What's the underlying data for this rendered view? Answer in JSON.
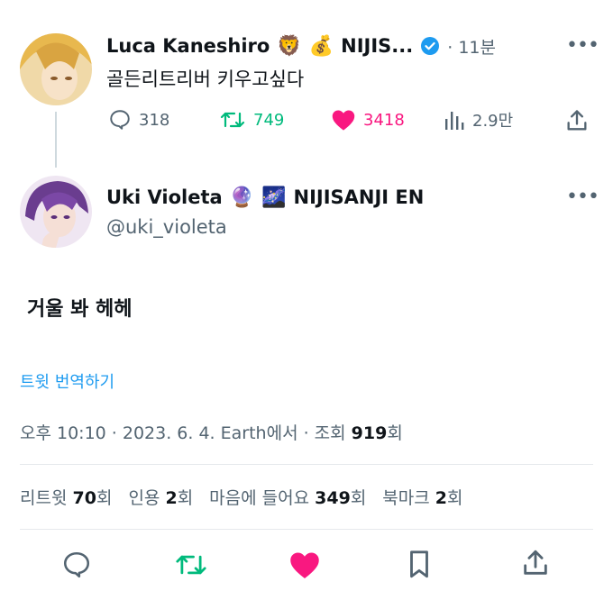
{
  "parent_tweet": {
    "display_name": "Luca Kaneshiro",
    "emojis": [
      "🦁",
      "💰"
    ],
    "name_suffix": "NIJIS...",
    "time": "· 11분",
    "text": "골든리트리버 키우고싶다",
    "replies": "318",
    "retweets": "749",
    "likes": "3418",
    "views": "2.9만"
  },
  "tweet": {
    "display_name": "Uki Violeta",
    "emojis": [
      "🔮",
      "🌌"
    ],
    "name_suffix": "NIJISANJI EN",
    "handle": "@uki_violeta",
    "text": "거울 봐 헤헤",
    "translate_label": "트윗 번역하기",
    "meta_prefix": "오후 10:10 · 2023. 6. 4. Earth에서 · 조회 ",
    "views_count": "919",
    "views_suffix": "회"
  },
  "stats": {
    "retweets_label": "리트윗",
    "retweets_count": "70",
    "quotes_label": "인용",
    "quotes_count": "2",
    "likes_label": "마음에 들어요",
    "likes_count": "349",
    "bookmarks_label": "북마크",
    "bookmarks_count": "2",
    "unit": "회"
  },
  "colors": {
    "text": "#0f1419",
    "muted": "#536471",
    "link": "#1d9bf0",
    "retweet": "#00ba7c",
    "like": "#f91880",
    "verified": "#1d9bf0"
  }
}
